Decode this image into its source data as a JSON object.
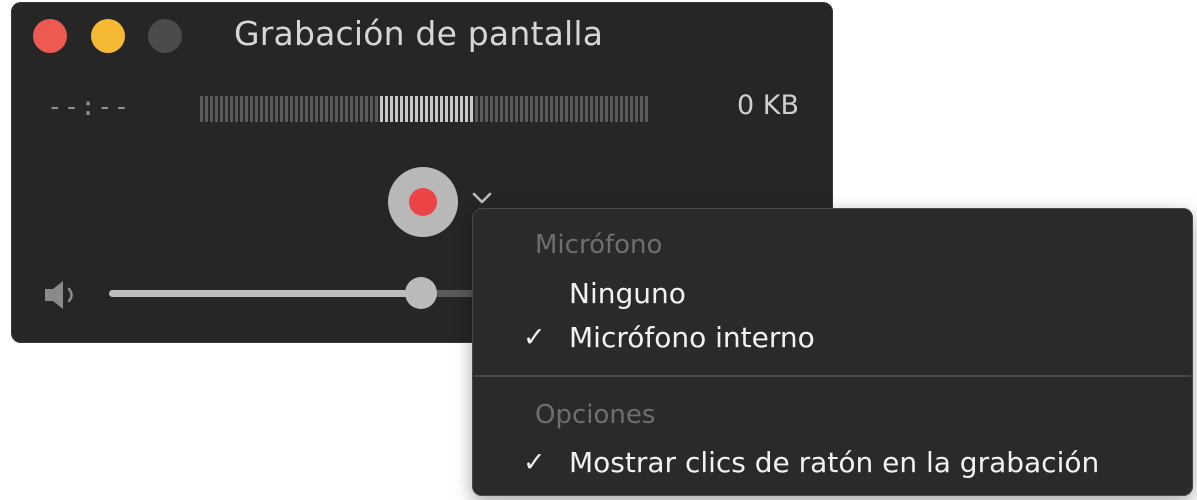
{
  "window": {
    "title": "Grabación de pantalla",
    "elapsed_time": "--:--",
    "file_size": "0 KB",
    "volume_level": 0.78,
    "audio_level": 0.1
  },
  "menu": {
    "sections": [
      {
        "header": "Micrófono",
        "items": [
          {
            "label": "Ninguno",
            "checked": false
          },
          {
            "label": "Micrófono interno",
            "checked": true
          }
        ]
      },
      {
        "header": "Opciones",
        "items": [
          {
            "label": "Mostrar clics de ratón en la grabación",
            "checked": true
          }
        ]
      }
    ],
    "check_glyph": "✓"
  },
  "icons": {
    "close": "close-icon",
    "minimize": "minimize-icon",
    "zoom": "zoom-icon",
    "record": "record-icon",
    "options": "chevron-down-icon",
    "volume": "speaker-icon"
  },
  "colors": {
    "close": "#ee5a52",
    "minimize": "#f5b933",
    "zoom": "#4b4b4b",
    "record": "#ec4446",
    "window_bg": "#262626",
    "menu_bg": "#2a2a2a"
  }
}
